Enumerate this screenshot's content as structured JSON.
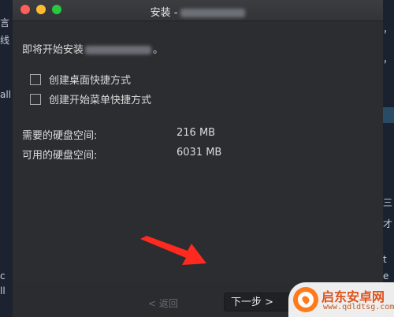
{
  "background_app": {
    "left_fragments": [
      "言",
      "线",
      "all",
      "c",
      "ll"
    ],
    "right_fragments": [
      "，",
      "，",
      "三",
      "才",
      "t",
      "e"
    ]
  },
  "window": {
    "title_prefix": "安装 -",
    "buttons": {
      "close_color": "#fe5f57",
      "minimize_color": "#febc2e",
      "zoom_color": "#28c840"
    }
  },
  "content": {
    "intro_prefix": "即将开始安装",
    "intro_suffix": "。",
    "options": [
      {
        "label": "创建桌面快捷方式",
        "checked": false
      },
      {
        "label": "创建开始菜单快捷方式",
        "checked": false
      }
    ],
    "disk": {
      "required_label": "需要的硬盘空间:",
      "required_value": "216 MB",
      "available_label": "可用的硬盘空间:",
      "available_value": "6031 MB"
    }
  },
  "footer": {
    "back_label": "< 返回",
    "next_label": "下一步 >"
  },
  "annotation": {
    "arrow_color": "#ff2a1f"
  },
  "watermark": {
    "name": "启东安卓网",
    "url": "www.qdldtsg.com"
  }
}
